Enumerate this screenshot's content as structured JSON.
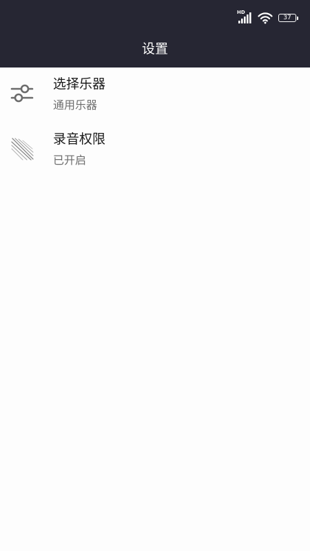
{
  "status_bar": {
    "network_label": "HD",
    "battery_level": "37",
    "icons": [
      "signal-icon",
      "wifi-icon",
      "battery-icon"
    ]
  },
  "header": {
    "title": "设置"
  },
  "settings": {
    "items": [
      {
        "icon": "sliders-icon",
        "title": "选择乐器",
        "subtitle": "通用乐器"
      },
      {
        "icon": "sound-lines-icon",
        "title": "录音权限",
        "subtitle": "已开启"
      }
    ]
  },
  "colors": {
    "header_bg": "#262633",
    "page_bg": "#fdfdfd",
    "title_text": "#1a1a1a",
    "subtitle_text": "#6d6d6d"
  }
}
